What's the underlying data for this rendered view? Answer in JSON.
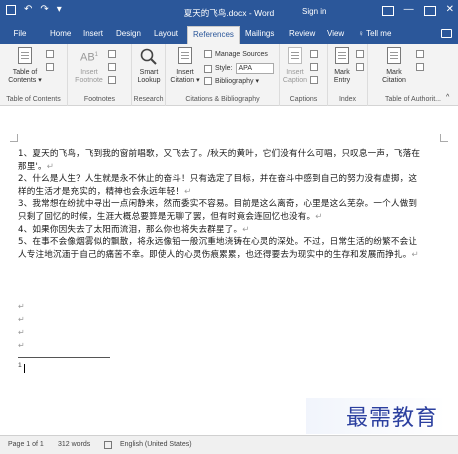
{
  "titlebar": {
    "undo": "↶",
    "redo": "↷",
    "customize": "▾",
    "title": "夏天的飞鸟.docx - Word",
    "sign_in": "Sign in",
    "minimize": "—",
    "close": "✕"
  },
  "tabs": {
    "file": "File",
    "items": [
      "Home",
      "Insert",
      "Design",
      "Layout",
      "References",
      "Mailings",
      "Review",
      "View"
    ],
    "active": "References",
    "tell_me": "Tell me"
  },
  "ribbon": {
    "toc": {
      "button": "Table of Contents",
      "button_line1": "Table of",
      "button_line2": "Contents ▾",
      "label": "Table of Contents"
    },
    "footnotes": {
      "insert_line1": "Insert",
      "insert_line2": "Footnote",
      "ab1": "AB",
      "ab_sup": "1",
      "label": "Footnotes"
    },
    "research": {
      "smart_line1": "Smart",
      "smart_line2": "Lookup",
      "label": "Research"
    },
    "citations": {
      "insert_line1": "Insert",
      "insert_line2": "Citation ▾",
      "manage_sources": "Manage Sources",
      "style_label": "Style:",
      "style_value": "APA",
      "bibliography": "Bibliography ▾",
      "label": "Citations & Bibliography"
    },
    "captions": {
      "insert_line1": "Insert",
      "insert_line2": "Caption",
      "label": "Captions"
    },
    "index": {
      "mark_line1": "Mark",
      "mark_line2": "Entry",
      "label": "Index"
    },
    "authorities": {
      "mark_line1": "Mark",
      "mark_line2": "Citation",
      "label": "Table of Authorit..."
    }
  },
  "document": {
    "paragraphs": [
      "1、夏天的飞鸟，飞到我的窗前唱歌，又飞去了。/秋天的黄叶，它们没有什么可唱，只叹息一声，飞落在那里'。",
      "2、什么是人生？人生就是永不休止的奋斗！只有选定了目标，并在奋斗中感到自己的努力没有虚掷，这样的生活才是充实的，精神也会永远年轻！",
      "3、我常想在纷扰中寻出一点闲静来，然而委实不容易。目前是这么离奇，心里是这么芜杂。一个人做到只剩了回忆的时候，生涯大概总要算是无聊了罢，但有时竟会连回忆也没有。",
      "4、如果你因失去了太阳而流泪，那么你也将失去群星了。",
      "5、在事不会像烟雾似的飘散，将永远像铅一般沉重地浇铸在心灵的深处。不过，日常生活的纷繁不会让人专注地沉湎于自己的痛苦不幸。即使人的心灵伤痕累累，也还得要去为现实中的生存和发展而挣扎。"
    ],
    "pilcrow": "↵",
    "footnote_number": "1"
  },
  "watermark": {
    "text": "最需教育"
  },
  "statusbar": {
    "page": "Page 1 of 1",
    "words": "312 words",
    "language": "English (United States)"
  },
  "colors": {
    "accent": "#2b579a",
    "watermark": "#2b3f9f"
  }
}
